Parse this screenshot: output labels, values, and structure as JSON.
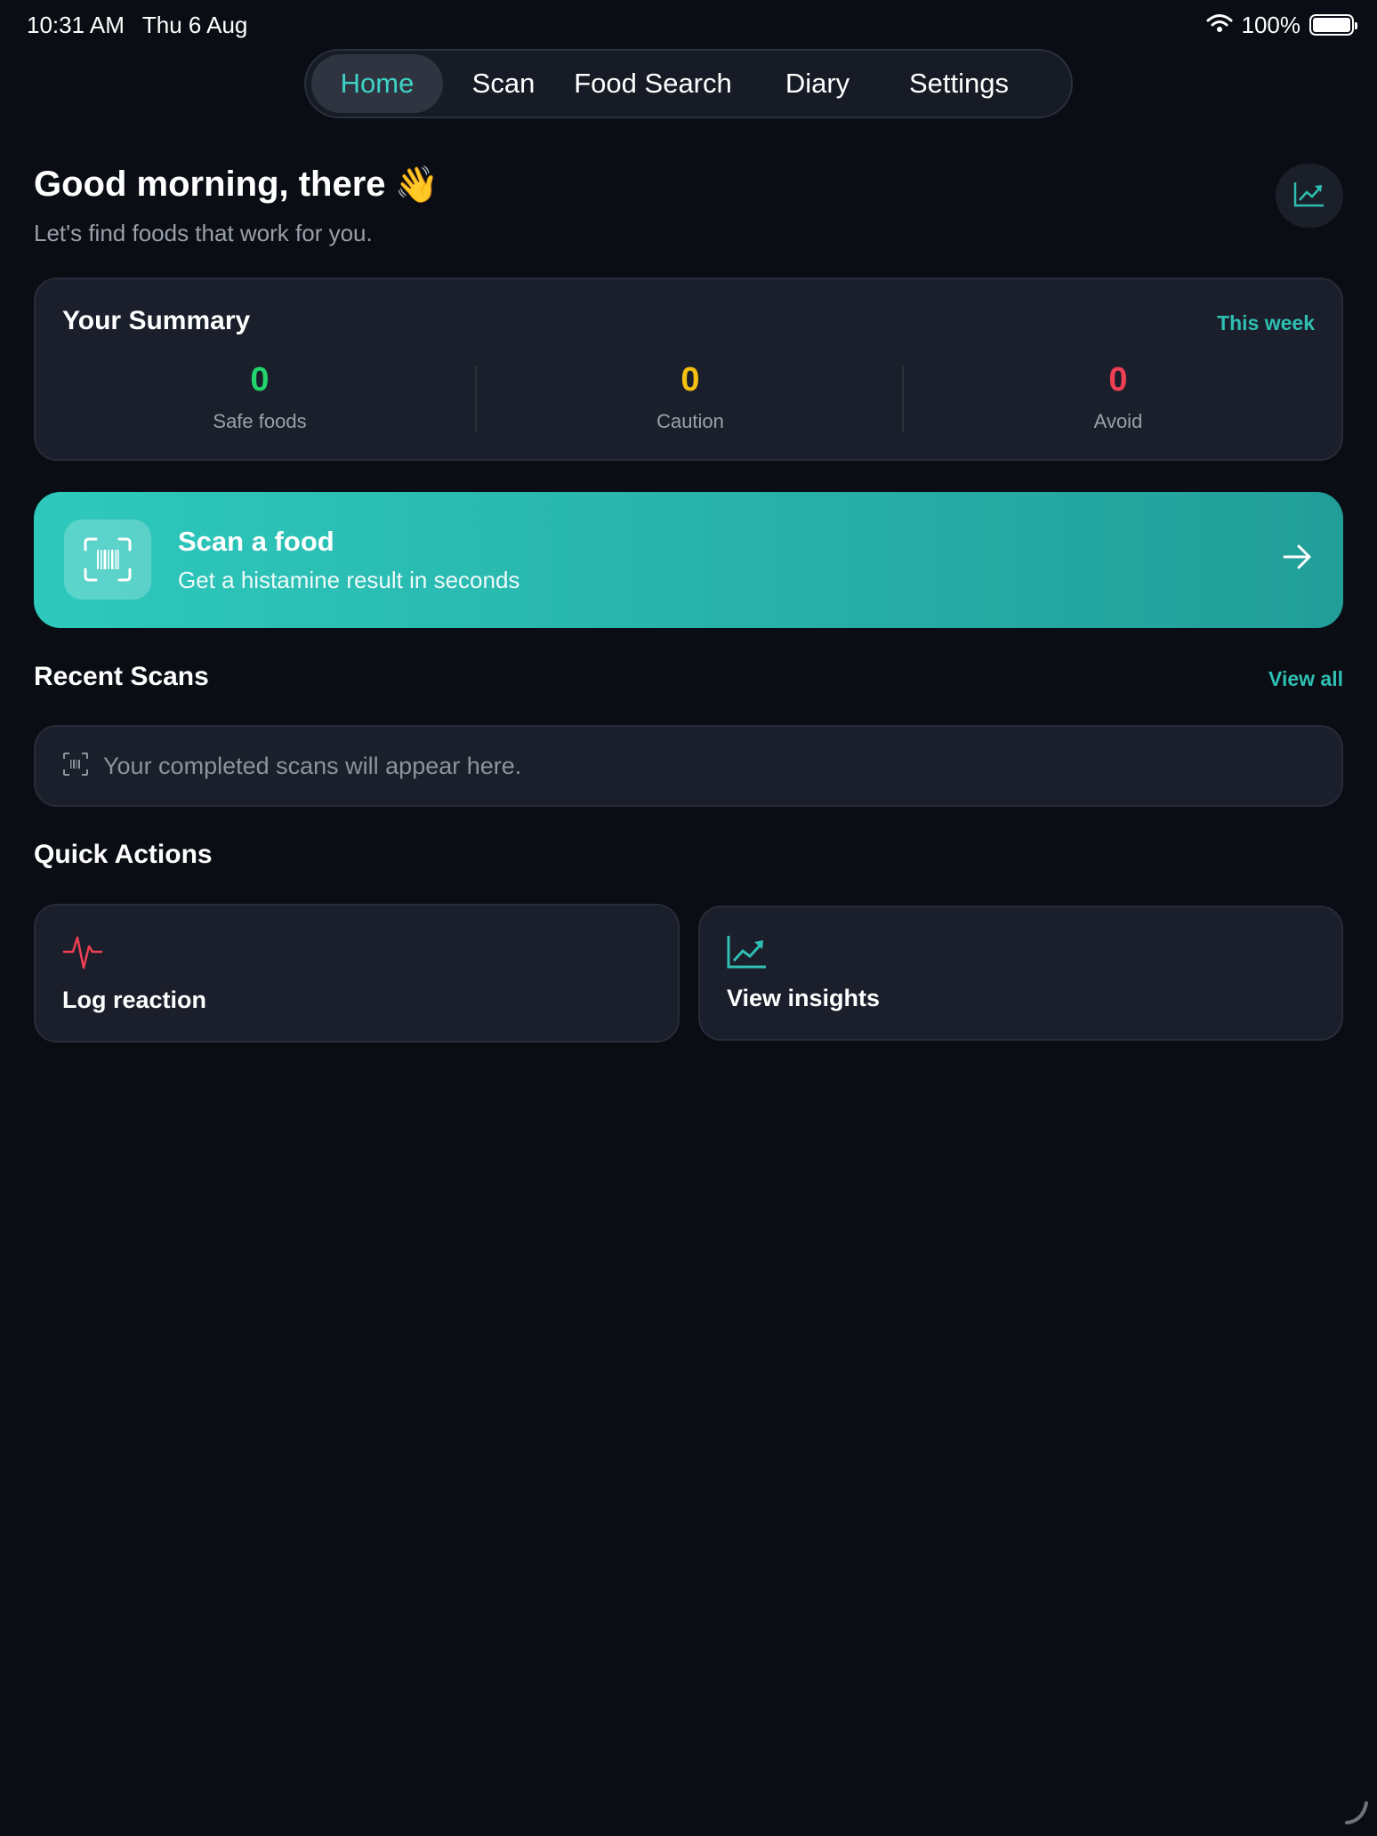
{
  "status_bar": {
    "time": "10:31 AM",
    "date": "Thu 6 Aug",
    "battery": "100%",
    "battery_level": 1.0
  },
  "nav": {
    "tabs": [
      "Home",
      "Scan",
      "Food Search",
      "Diary",
      "Settings"
    ],
    "active": "Home"
  },
  "greeting": {
    "title": "Good morning, there",
    "emoji": "👋",
    "subtitle": "Let's find foods that work for you."
  },
  "summary": {
    "title": "Your Summary",
    "period": "This week",
    "stats": [
      {
        "value": "0",
        "label": "Safe foods",
        "color": "#22d46b"
      },
      {
        "value": "0",
        "label": "Caution",
        "color": "#f5c012"
      },
      {
        "value": "0",
        "label": "Avoid",
        "color": "#ef3f55"
      }
    ]
  },
  "scan_banner": {
    "title": "Scan a food",
    "subtitle": "Get a histamine result in seconds",
    "icon": "barcode-scan-icon"
  },
  "recent_scans": {
    "title": "Recent Scans",
    "view_all": "View all",
    "empty_text": "Your completed scans will appear here."
  },
  "quick_actions": {
    "title": "Quick Actions",
    "items": [
      {
        "label": "Log reaction",
        "icon": "pulse-icon",
        "color": "#ef3f55"
      },
      {
        "label": "View insights",
        "icon": "trend-chart-icon",
        "color": "#2fbfb2"
      }
    ]
  },
  "colors": {
    "accent": "#2fbfb2",
    "active_tab": "#3ed3c6",
    "background": "#0a0d14",
    "card": "#1b1f2b"
  }
}
